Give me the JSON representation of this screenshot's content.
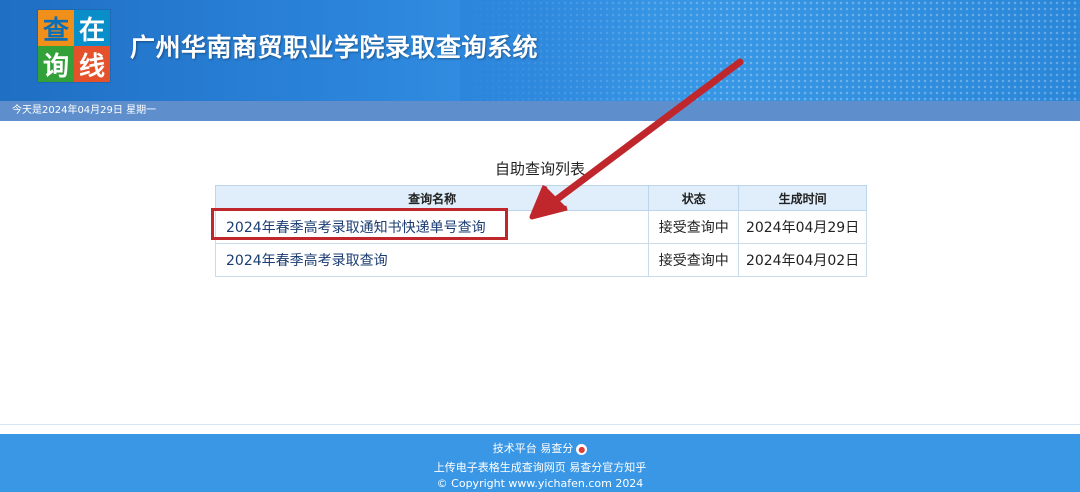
{
  "header": {
    "logo": {
      "chars": [
        "查",
        "在",
        "询",
        "线"
      ]
    },
    "title": "广州华南商贸职业学院录取查询系统",
    "date_text": "今天是2024年04月29日  星期一"
  },
  "main": {
    "list_title": "自助查询列表",
    "columns": [
      "查询名称",
      "状态",
      "生成时间"
    ],
    "rows": [
      {
        "name": "2024年春季高考录取通知书快递单号查询",
        "status": "接受查询中",
        "time": "2024年04月29日"
      },
      {
        "name": "2024年春季高考录取查询",
        "status": "接受查询中",
        "time": "2024年04月02日"
      }
    ]
  },
  "footer": {
    "line1": "技术平台 易查分",
    "line2": "上传电子表格生成查询网页 易查分官方知乎",
    "line3": "© Copyright www.yichafen.com 2024"
  },
  "colors": {
    "header_blue": "#2c86dc",
    "date_bar": "#5e8fcc",
    "highlight_red": "#c0272d",
    "footer_blue": "#3a97e6"
  }
}
